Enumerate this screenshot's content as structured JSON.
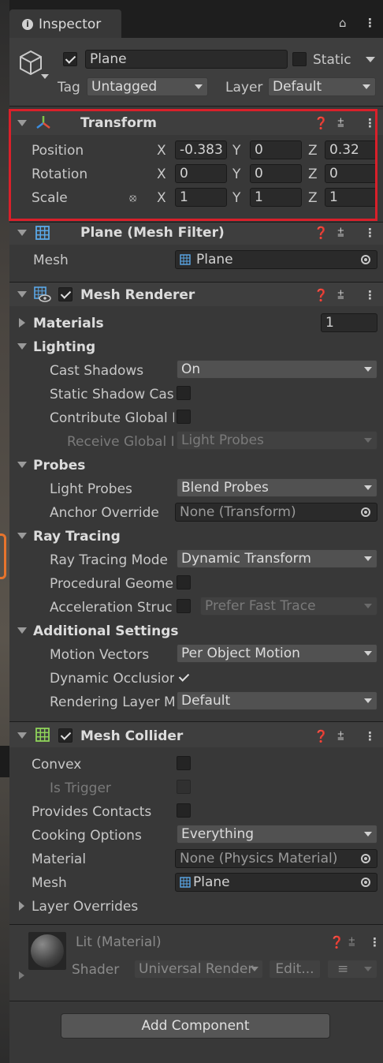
{
  "tab": {
    "title": "Inspector"
  },
  "object": {
    "name": "Plane",
    "static_label": "Static",
    "tag_label": "Tag",
    "tag_value": "Untagged",
    "layer_label": "Layer",
    "layer_value": "Default"
  },
  "transform": {
    "title": "Transform",
    "position_label": "Position",
    "rotation_label": "Rotation",
    "scale_label": "Scale",
    "axis_x": "X",
    "axis_y": "Y",
    "axis_z": "Z",
    "position": {
      "x": "-0.383",
      "y": "0",
      "z": "0.32"
    },
    "rotation": {
      "x": "0",
      "y": "0",
      "z": "0"
    },
    "scale": {
      "x": "1",
      "y": "1",
      "z": "1"
    }
  },
  "mesh_filter": {
    "title": "Plane (Mesh Filter)",
    "mesh_label": "Mesh",
    "mesh_value": "Plane"
  },
  "mesh_renderer": {
    "title": "Mesh Renderer",
    "materials_label": "Materials",
    "materials_count": "1",
    "lighting_label": "Lighting",
    "cast_shadows_label": "Cast Shadows",
    "cast_shadows_value": "On",
    "static_shadow_label": "Static Shadow Cas",
    "contribute_gi_label": "Contribute Global I",
    "receive_gi_label": "Receive Global I",
    "receive_gi_value": "Light Probes",
    "probes_label": "Probes",
    "light_probes_label": "Light Probes",
    "light_probes_value": "Blend Probes",
    "anchor_label": "Anchor Override",
    "anchor_value": "None (Transform)",
    "ray_tracing_label": "Ray Tracing",
    "rt_mode_label": "Ray Tracing Mode",
    "rt_mode_value": "Dynamic Transform",
    "procedural_label": "Procedural Geome",
    "accel_label": "Acceleration Struc",
    "accel_value": "Prefer Fast Trace",
    "additional_label": "Additional Settings",
    "motion_label": "Motion Vectors",
    "motion_value": "Per Object Motion",
    "occlusion_label": "Dynamic Occlusion",
    "rendering_layer_label": "Rendering Layer M",
    "rendering_layer_value": "Default"
  },
  "mesh_collider": {
    "title": "Mesh Collider",
    "convex_label": "Convex",
    "is_trigger_label": "Is Trigger",
    "contacts_label": "Provides Contacts",
    "cooking_label": "Cooking Options",
    "cooking_value": "Everything",
    "material_label": "Material",
    "material_value": "None (Physics Material)",
    "mesh_label": "Mesh",
    "mesh_value": "Plane",
    "layer_overrides_label": "Layer Overrides"
  },
  "material": {
    "name": "Lit (Material)",
    "shader_label": "Shader",
    "shader_value": "Universal Render",
    "edit_label": "Edit..."
  },
  "add_component": {
    "label": "Add Component"
  },
  "colors": {
    "highlight": "#d9202a",
    "panel": "#383838",
    "header": "#3e3e3e",
    "accent_orange": "#e8742c"
  }
}
